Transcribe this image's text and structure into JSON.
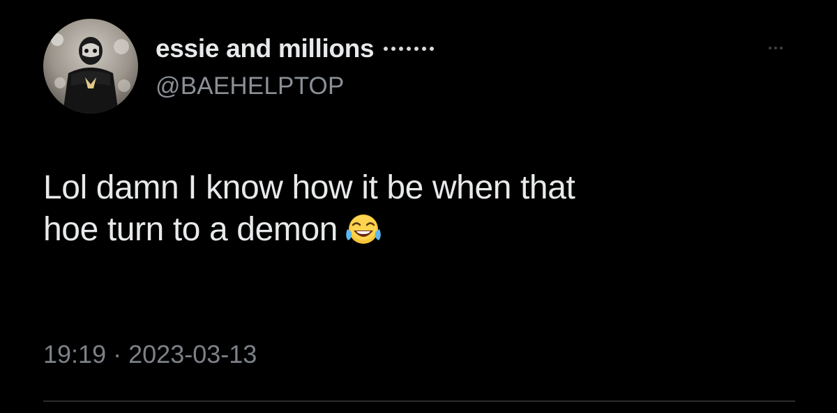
{
  "tweet": {
    "author": {
      "display_name": "essie and millions",
      "handle": "@BAEHELPTOP",
      "avatar_icon": "profile-photo"
    },
    "text_lines": [
      "Lol damn I know how it be when that",
      "hoe turn to a demon"
    ],
    "emoji": "face-with-tears-of-joy",
    "time": "19:19",
    "separator": "·",
    "date": "2023-03-13"
  },
  "colors": {
    "background": "#000000",
    "primary_text": "#e7e9ea",
    "secondary_text": "#8b9096",
    "divider": "#2a2d30"
  }
}
